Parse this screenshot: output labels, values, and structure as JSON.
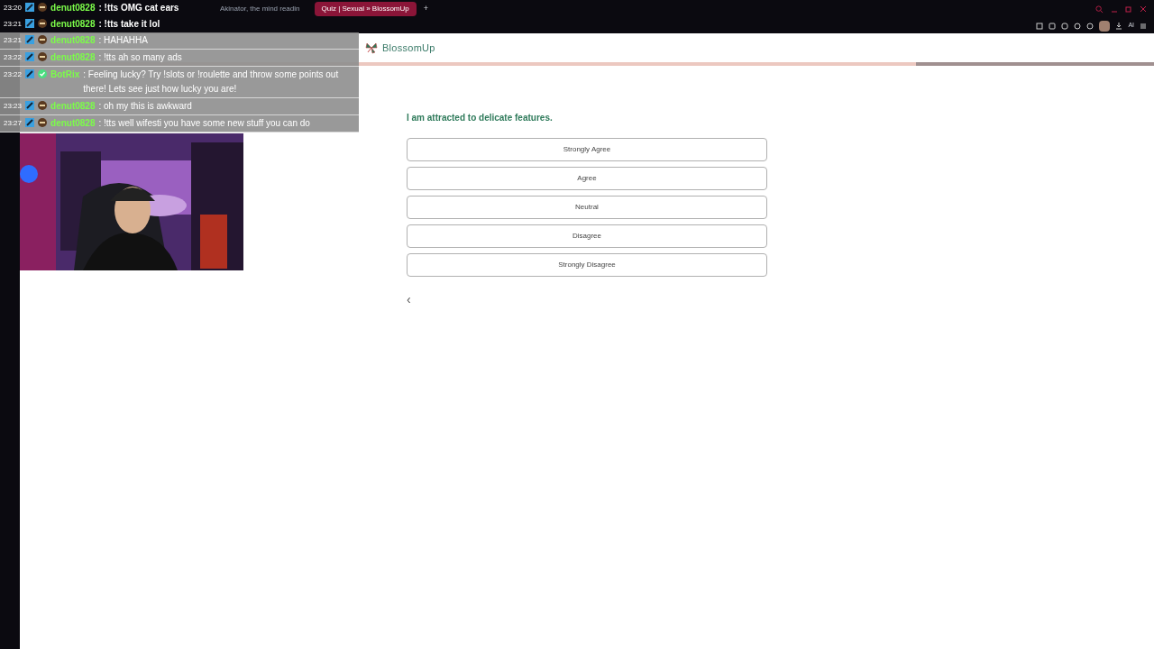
{
  "browser": {
    "tabs": [
      {
        "title": "Akinator, the mind readin",
        "selected": false
      },
      {
        "title": "Quiz | Sexual » BlossomUp",
        "selected": true
      }
    ],
    "new_tab": "+",
    "ai_label": "AI"
  },
  "site": {
    "logo": "BlossomUp",
    "progress": {
      "level": 0.79
    }
  },
  "quiz": {
    "question": "I am attracted to delicate features.",
    "options": [
      {
        "label": "Strongly Agree",
        "selected": false
      },
      {
        "label": "Agree",
        "selected": false
      },
      {
        "label": "Neutral",
        "selected": false
      },
      {
        "label": "Disagree",
        "selected": false
      },
      {
        "label": "Strongly Disagree",
        "selected": false
      }
    ],
    "back": "‹"
  },
  "chat": [
    {
      "time": "23:20",
      "user": "denut0828",
      "text": ": !tts OMG cat ears",
      "kind": "user"
    },
    {
      "time": "23:21",
      "user": "denut0828",
      "text": ": !tts take it lol",
      "kind": "user"
    },
    {
      "time": "23:21",
      "user": "denut0828",
      "text": ": HAHAHHA",
      "kind": "user"
    },
    {
      "time": "23:22",
      "user": "denut0828",
      "text": ": !tts ah so many ads",
      "kind": "user"
    },
    {
      "time": "23:22",
      "user": "BotRix",
      "text": ": Feeling lucky? Try !slots or !roulette and throw some points out there! Lets see just how lucky you are!",
      "kind": "bot"
    },
    {
      "time": "23:23",
      "user": "denut0828",
      "text": ": oh my this is awkward",
      "kind": "user"
    },
    {
      "time": "23:27",
      "user": "denut0828",
      "text": ": !tts well wifesti you have some new stuff you can do",
      "kind": "user"
    }
  ]
}
